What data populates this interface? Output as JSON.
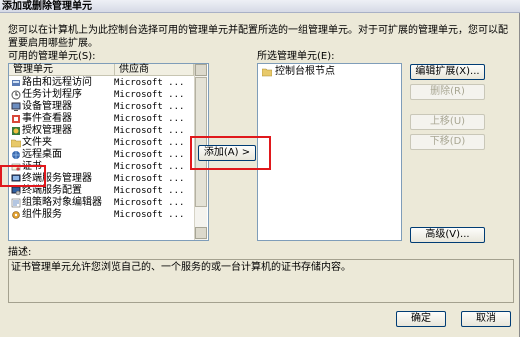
{
  "window": {
    "title": "添加或删除管理单元"
  },
  "intro_text": "您可以在计算机上为此控制台选择可用的管理单元并配置所选的一组管理单元。对于可扩展的管理单元，您可以配置要启用哪些扩展。",
  "available": {
    "label": "可用的管理单元(S):",
    "columns": [
      "管理单元",
      "供应商"
    ],
    "items": [
      {
        "name": "路由和远程访问",
        "vendor": "Microsoft ..."
      },
      {
        "name": "任务计划程序",
        "vendor": "Microsoft ..."
      },
      {
        "name": "设备管理器",
        "vendor": "Microsoft ..."
      },
      {
        "name": "事件查看器",
        "vendor": "Microsoft ..."
      },
      {
        "name": "授权管理器",
        "vendor": "Microsoft ..."
      },
      {
        "name": "文件夹",
        "vendor": "Microsoft ..."
      },
      {
        "name": "远程桌面",
        "vendor": "Microsoft ..."
      },
      {
        "name": "证书",
        "vendor": "Microsoft ..."
      },
      {
        "name": "终端服务管理器",
        "vendor": "Microsoft ..."
      },
      {
        "name": "终端服务配置",
        "vendor": "Microsoft ..."
      },
      {
        "name": "组策略对象编辑器",
        "vendor": "Microsoft ..."
      },
      {
        "name": "组件服务",
        "vendor": "Microsoft ..."
      }
    ]
  },
  "add_button": "添加(A) >",
  "selected": {
    "label": "所选管理单元(E):",
    "items": [
      "控制台根节点"
    ]
  },
  "buttons": {
    "edit_extensions": "编辑扩展(X)...",
    "remove": "删除(R)",
    "move_up": "上移(U)",
    "move_down": "下移(D)",
    "advanced": "高级(V)...",
    "ok": "确定",
    "cancel": "取消"
  },
  "description": {
    "label": "描述:",
    "text": "证书管理单元允许您浏览自己的、一个服务的或一台计算机的证书存储内容。"
  },
  "colors": {
    "highlight_box": "#e0181c",
    "folder": "#e8c96a"
  }
}
